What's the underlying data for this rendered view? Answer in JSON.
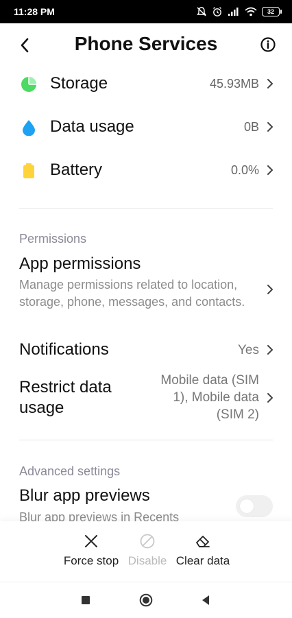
{
  "status_bar": {
    "time": "11:28 PM",
    "battery": "32"
  },
  "header": {
    "title": "Phone Services"
  },
  "usage": [
    {
      "label": "Storage",
      "value": "45.93MB",
      "icon": "storage-pie-icon",
      "color": "#4cd964"
    },
    {
      "label": "Data usage",
      "value": "0B",
      "icon": "water-drop-icon",
      "color": "#1da1f2"
    },
    {
      "label": "Battery",
      "value": "0.0%",
      "icon": "battery-icon",
      "color": "#ffd43b"
    }
  ],
  "permissions": {
    "section_title": "Permissions",
    "app_permissions": {
      "title": "App permissions",
      "subtitle": "Manage permissions related to location, storage, phone, messages, and contacts."
    },
    "notifications": {
      "title": "Notifications",
      "value": "Yes"
    },
    "restrict_data": {
      "title": "Restrict data usage",
      "value": "Mobile data (SIM 1), Mobile data (SIM 2)"
    }
  },
  "advanced": {
    "section_title": "Advanced settings",
    "blur_previews": {
      "title": "Blur app previews",
      "subtitle": "Blur app previews in Recents",
      "enabled": false
    }
  },
  "actions": {
    "force_stop": "Force stop",
    "disable": "Disable",
    "clear_data": "Clear data"
  }
}
